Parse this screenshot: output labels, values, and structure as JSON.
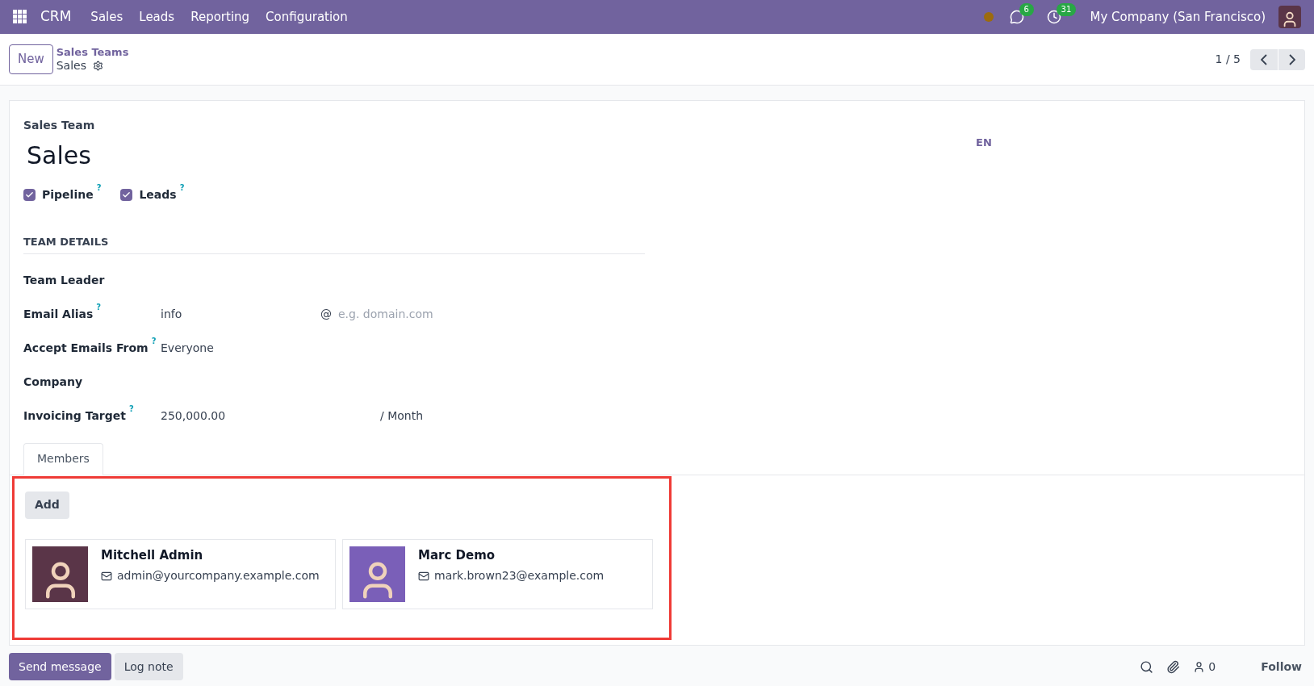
{
  "navbar": {
    "app": "CRM",
    "menu": [
      "Sales",
      "Leads",
      "Reporting",
      "Configuration"
    ],
    "messages_count": "6",
    "activities_count": "31",
    "company": "My Company (San Francisco)"
  },
  "control_panel": {
    "new_button": "New",
    "breadcrumb": "Sales Teams",
    "record": "Sales",
    "pager": "1 / 5"
  },
  "form": {
    "title_label": "Sales Team",
    "title": "Sales",
    "language": "EN",
    "options": [
      {
        "label": "Pipeline",
        "help": "?",
        "checked": true
      },
      {
        "label": "Leads",
        "help": "?",
        "checked": true
      }
    ],
    "section": "TEAM DETAILS",
    "fields": [
      {
        "label": "Team Leader"
      },
      {
        "label": "Email Alias",
        "help": "?",
        "value": "info",
        "extra": "@",
        "placeholder": "e.g. domain.com"
      },
      {
        "label": "Accept Emails From",
        "help": "?",
        "value": "Everyone"
      },
      {
        "label": "Company"
      },
      {
        "label": "Invoicing Target",
        "help": "?",
        "value": "250,000.00",
        "suffix": "/ Month"
      }
    ],
    "tabs": [
      {
        "label": "Members",
        "selected": true
      }
    ],
    "add_button": "Add",
    "members": [
      {
        "name": "Mitchell Admin",
        "email": "admin@yourcompany.example.com",
        "color": "#5a3548"
      },
      {
        "name": "Marc Demo",
        "email": "mark.brown23@example.com",
        "color": "#7a5fb8"
      }
    ]
  },
  "chatter": {
    "send_message": "Send message",
    "log_note": "Log note",
    "followers": "0",
    "follow": "Follow"
  }
}
